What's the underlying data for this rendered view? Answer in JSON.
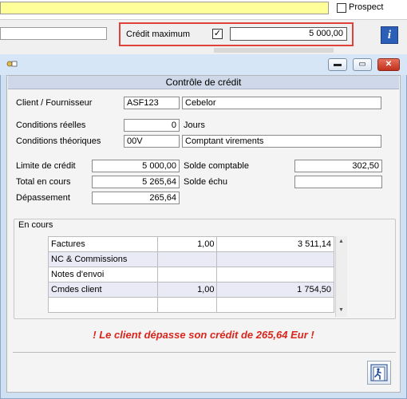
{
  "background": {
    "prospect_label": "Prospect",
    "credit_max_label": "Crédit maximum",
    "credit_max_checked": "✓",
    "credit_max_value": "5 000,00",
    "info_icon": "i",
    "highlight_color": "#e0413a"
  },
  "dialog": {
    "title": "Contrôle de crédit",
    "window_buttons": {
      "minimize": "▬",
      "maximize": "▭",
      "close": "✕"
    },
    "client_label": "Client / Fournisseur",
    "client_code": "ASF123",
    "client_name": "Cebelor",
    "cond_reelles_label": "Conditions réelles",
    "cond_reelles_value": "0",
    "jours_label": "Jours",
    "cond_theo_label": "Conditions théoriques",
    "cond_theo_code": "00V",
    "cond_theo_desc": "Comptant virements",
    "limite_label": "Limite de crédit",
    "limite_value": "5 000,00",
    "total_label": "Total en cours",
    "total_value": "5 265,64",
    "depassement_label": "Dépassement",
    "depassement_value": "265,64",
    "solde_comptable_label": "Solde comptable",
    "solde_comptable_value": "302,50",
    "solde_echu_label": "Solde échu",
    "solde_echu_value": "",
    "en_cours_label": "En cours",
    "rows": [
      {
        "label": "Factures",
        "qty": "1,00",
        "amount": "3 511,14"
      },
      {
        "label": "NC & Commissions",
        "qty": "",
        "amount": ""
      },
      {
        "label": "Notes d'envoi",
        "qty": "",
        "amount": ""
      },
      {
        "label": "Cmdes client",
        "qty": "1,00",
        "amount": "1 754,50"
      },
      {
        "label": "",
        "qty": "",
        "amount": ""
      }
    ],
    "warning": "! Le client dépasse son crédit de 265,64 Eur !",
    "warning_color": "#d9261c"
  }
}
